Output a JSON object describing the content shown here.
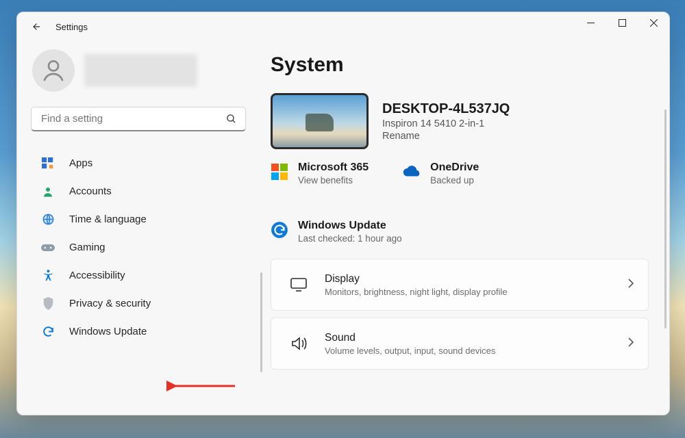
{
  "window": {
    "title": "Settings"
  },
  "user": {
    "name_redacted": true
  },
  "search": {
    "placeholder": "Find a setting"
  },
  "nav": [
    {
      "id": "apps",
      "label": "Apps",
      "icon": "apps"
    },
    {
      "id": "accounts",
      "label": "Accounts",
      "icon": "person"
    },
    {
      "id": "time-language",
      "label": "Time & language",
      "icon": "globe"
    },
    {
      "id": "gaming",
      "label": "Gaming",
      "icon": "gamepad"
    },
    {
      "id": "accessibility",
      "label": "Accessibility",
      "icon": "accessibility"
    },
    {
      "id": "privacy",
      "label": "Privacy & security",
      "icon": "shield"
    },
    {
      "id": "windows-update",
      "label": "Windows Update",
      "icon": "update"
    }
  ],
  "page": {
    "title": "System",
    "device": {
      "name": "DESKTOP-4L537JQ",
      "model": "Inspiron 14 5410 2-in-1",
      "rename": "Rename"
    },
    "tiles": {
      "m365": {
        "title": "Microsoft 365",
        "sub": "View benefits"
      },
      "onedrive": {
        "title": "OneDrive",
        "sub": "Backed up"
      },
      "wu": {
        "title": "Windows Update",
        "sub": "Last checked: 1 hour ago"
      }
    },
    "cards": [
      {
        "id": "display",
        "title": "Display",
        "sub": "Monitors, brightness, night light, display profile"
      },
      {
        "id": "sound",
        "title": "Sound",
        "sub": "Volume levels, output, input, sound devices"
      }
    ]
  }
}
